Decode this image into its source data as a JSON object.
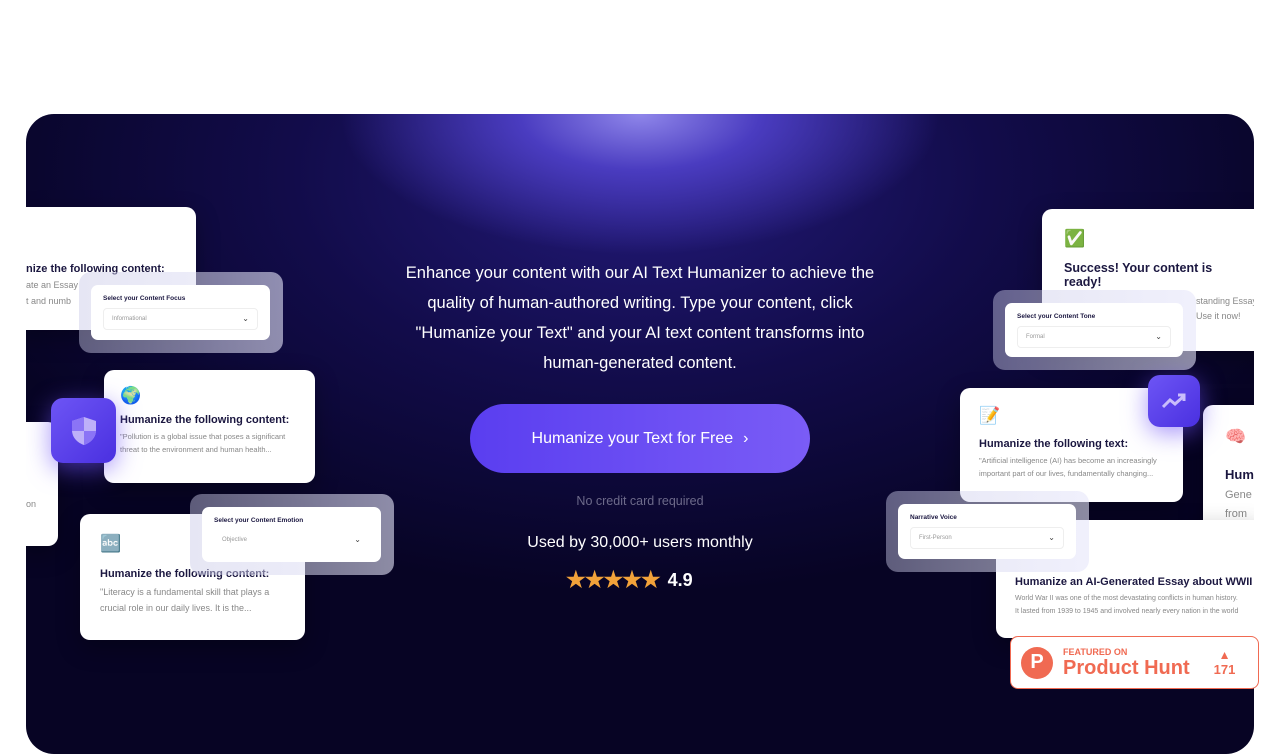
{
  "hero": {
    "description": "Enhance your content with our AI Text Humanizer to achieve the quality of human-authored writing. Type your content, click \"Humanize your Text\" and your AI text content transforms into human-generated content.",
    "cta_label": "Humanize your Text for Free",
    "cta_icon": "chevron-right-icon",
    "no_credit": "No credit card required",
    "users": "Used by 30,000+ users monthly",
    "stars": "★★★★★",
    "rating": "4.9",
    "accent": "#5b3ff0"
  },
  "left": {
    "card1": {
      "title": "nize the following content:",
      "line1": "ate an Essay",
      "line2": "t and numb"
    },
    "card2": {
      "text": "on"
    },
    "focus": {
      "label": "Select your Content Focus",
      "value": "Informational"
    },
    "globe": {
      "emoji": "🌍",
      "title": "Humanize the following content:",
      "text": "\"Pollution is a global issue that poses a significant threat to the environment and human health..."
    },
    "abc": {
      "emoji": "🔤",
      "title": "Humanize the following content:",
      "text": "\"Literacy is a fundamental skill that plays a crucial role in our daily lives. It is the..."
    },
    "emotion": {
      "label": "Select your Content Emotion",
      "value": "Objective"
    }
  },
  "right": {
    "success": {
      "emoji": "✅",
      "title": "Success! Your content is ready!",
      "line1": "standing Essay",
      "line2": "Use it now!"
    },
    "tone": {
      "label": "Select your Content Tone",
      "value": "Formal"
    },
    "pencil": {
      "emoji": "📝",
      "title": "Humanize the following text:",
      "text": "\"Artificial intelligence (AI) has become an increasingly important part of our lives, fundamentally changing..."
    },
    "brain": {
      "emoji": "🧠",
      "title": "Hum",
      "line1": "Gene",
      "line2": "from"
    },
    "wwii": {
      "title": "Humanize an AI-Generated Essay about WWII",
      "line1": "World War II was one of the most devastating conflicts in human history.",
      "line2": "It lasted from 1939 to 1945 and involved nearly every nation in the world"
    },
    "voice": {
      "label": "Narrative Voice",
      "value": "First-Person"
    }
  },
  "product_hunt": {
    "featured": "FEATURED ON",
    "name": "Product Hunt",
    "votes": "171",
    "logo": "P",
    "color": "#f06a52"
  }
}
